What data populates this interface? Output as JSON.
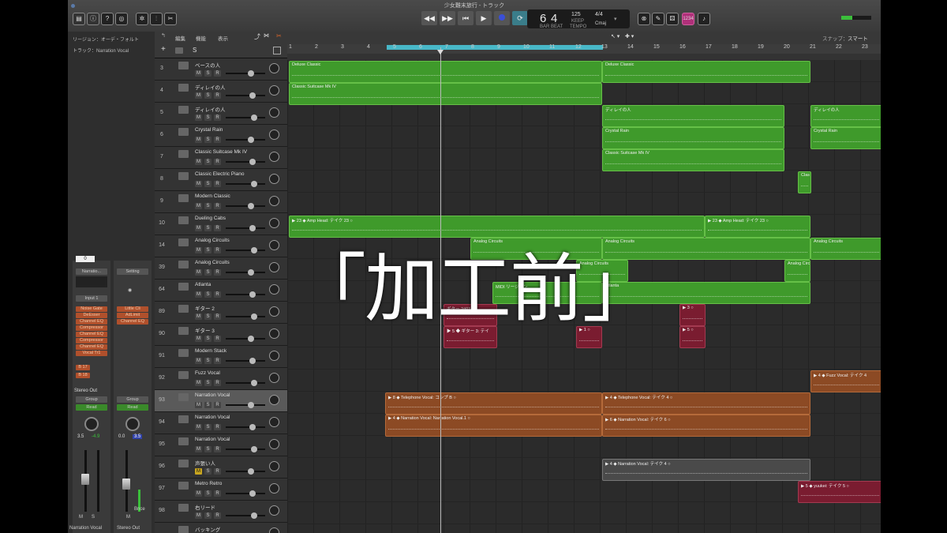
{
  "window": {
    "title": "少女難末旅行 - トラック"
  },
  "lcd": {
    "bar": "6",
    "beat": "4",
    "bar_label": "BAR",
    "beat_label": "BEAT",
    "tempo": "125",
    "tempo_label": "KEEP",
    "tempo_sub": "TEMPO",
    "sig": "4/4",
    "key": "Cmaj"
  },
  "badge": "1234",
  "left_panel": {
    "region_label": "リージョン：オーデ・フォルト",
    "track_label": "トラック：Narration Vocal",
    "strip1": {
      "value": "0",
      "setting": "Narratio...",
      "input": "Input 1",
      "plugins": [
        "Noise Gate",
        "DeEsser",
        "Channel EQ",
        "Compressor",
        "Channel EQ",
        "Compressor",
        "Channel EQ",
        "Vocal Tr1"
      ],
      "sends": [
        "B 17",
        "B 18"
      ],
      "output": "Stereo Out",
      "group": "Group",
      "mode": "Read",
      "db1": "3.5",
      "db2": "-4.9",
      "name": "Narration Vocal",
      "m": "M",
      "s": "S"
    },
    "strip2": {
      "setting": "Setting",
      "plugins": [
        "Little Cli",
        "AdLimit",
        "Channel EQ"
      ],
      "group": "Group",
      "mode": "Read",
      "db1": "0.0",
      "db2": "3.5",
      "bnce": "Bnce",
      "name": "Stereo Out",
      "m": "M"
    }
  },
  "toolbar": {
    "edit": "編集",
    "func": "機能",
    "view": "表示",
    "snap_label": "スナップ：",
    "snap_value": "スマート"
  },
  "ruler": [
    "1",
    "2",
    "3",
    "4",
    "5",
    "6",
    "7",
    "8",
    "9",
    "10",
    "11",
    "12",
    "13",
    "14",
    "15",
    "16",
    "17",
    "18",
    "19",
    "20",
    "21",
    "22",
    "23"
  ],
  "tracks": [
    {
      "num": "3",
      "name": "ベースの人"
    },
    {
      "num": "4",
      "name": "ディレイの人"
    },
    {
      "num": "5",
      "name": "ディレイの人"
    },
    {
      "num": "6",
      "name": "Crystal Rain"
    },
    {
      "num": "7",
      "name": "Classic Suitcase Mk IV"
    },
    {
      "num": "8",
      "name": "Classic Electric Piano"
    },
    {
      "num": "9",
      "name": "Modern Classic"
    },
    {
      "num": "10",
      "name": "Dueling Cabs"
    },
    {
      "num": "14",
      "name": "Analog Circuits"
    },
    {
      "num": "39",
      "name": "Analog Circuits"
    },
    {
      "num": "64",
      "name": "Atlanta"
    },
    {
      "num": "89",
      "name": "ギター 2"
    },
    {
      "num": "90",
      "name": "ギター 3"
    },
    {
      "num": "91",
      "name": "Modern Stack"
    },
    {
      "num": "92",
      "name": "Fuzz Vocal"
    },
    {
      "num": "93",
      "name": "Narration Vocal"
    },
    {
      "num": "94",
      "name": "Narration Vocal"
    },
    {
      "num": "95",
      "name": "Narration Vocal"
    },
    {
      "num": "96",
      "name": "声張い人"
    },
    {
      "num": "97",
      "name": "Metro Retro"
    },
    {
      "num": "98",
      "name": "右リード"
    },
    {
      "num": "",
      "name": "バッキング"
    }
  ],
  "track_buttons": {
    "m": "M",
    "s": "S",
    "r": "R"
  },
  "regions": [
    {
      "lane": 0,
      "c": "g",
      "label": "Deluxe Classic"
    },
    {
      "lane": 0,
      "c": "g",
      "label": "Deluxe Classic"
    },
    {
      "lane": 1,
      "c": "g",
      "label": "Classic Suitcase Mk IV"
    },
    {
      "lane": 2,
      "c": "g",
      "label": "ディレイの人"
    },
    {
      "lane": 2,
      "c": "g",
      "label": "ディレイの人"
    },
    {
      "lane": 3,
      "c": "g",
      "label": "Crystal Rain"
    },
    {
      "lane": 3,
      "c": "g",
      "label": "Crystal Rain"
    },
    {
      "lane": 4,
      "c": "g",
      "label": "Classic Suitcase Mk IV"
    },
    {
      "lane": 5,
      "c": "g",
      "label": "Clas"
    },
    {
      "lane": 7,
      "c": "g",
      "label": "▶ 23 ◆ Amp Head: テイク 23 ○"
    },
    {
      "lane": 7,
      "c": "g",
      "label": "▶ 23 ◆ Amp Head: テイク 23 ○"
    },
    {
      "lane": 8,
      "c": "g",
      "label": "Analog Circuits"
    },
    {
      "lane": 8,
      "c": "g",
      "label": "Analog Circuits"
    },
    {
      "lane": 8,
      "c": "g",
      "label": "Analog Circuits"
    },
    {
      "lane": 9,
      "c": "g",
      "label": "Analog Circuits"
    },
    {
      "lane": 9,
      "c": "g",
      "label": "Analog Circuits"
    },
    {
      "lane": 10,
      "c": "g",
      "label": "MIDI リージョン"
    },
    {
      "lane": 10,
      "c": "g",
      "label": "Atlanta"
    },
    {
      "lane": 11,
      "c": "r",
      "label": "ギター 2#03"
    },
    {
      "lane": 11,
      "c": "r",
      "label": "▶ 3 ○"
    },
    {
      "lane": 12,
      "c": "r",
      "label": "▶ 5 ◆ ギター 3: テイ"
    },
    {
      "lane": 12,
      "c": "r",
      "label": "▶ 1 ○"
    },
    {
      "lane": 12,
      "c": "r",
      "label": "▶ 5 ○"
    },
    {
      "lane": 14,
      "c": "o",
      "label": "▶ 4 ◆ Fuzz Vocal: テイク 4"
    },
    {
      "lane": 15,
      "c": "o",
      "label": "▶ 8 ◆ Telephone Vocal: コンプ B ○"
    },
    {
      "lane": 15,
      "c": "o",
      "label": "▶ 4 ◆ Telephone Vocal: テイク 4 ○"
    },
    {
      "lane": 16,
      "c": "o",
      "label": "▶ 4 ◆ Narration Vocal: Narration Vocal.1 ○"
    },
    {
      "lane": 16,
      "c": "o",
      "label": "▶ 6 ◆ Narration Vocal: テイク 6 ○"
    },
    {
      "lane": 18,
      "c": "gr",
      "label": "▶ 4 ◆ Narration Vocal: テイク 4 ○"
    },
    {
      "lane": 19,
      "c": "r",
      "label": "▶ 5 ◆ yuukei: テイク 5 ○"
    }
  ],
  "overlay_text": "「加工前」"
}
